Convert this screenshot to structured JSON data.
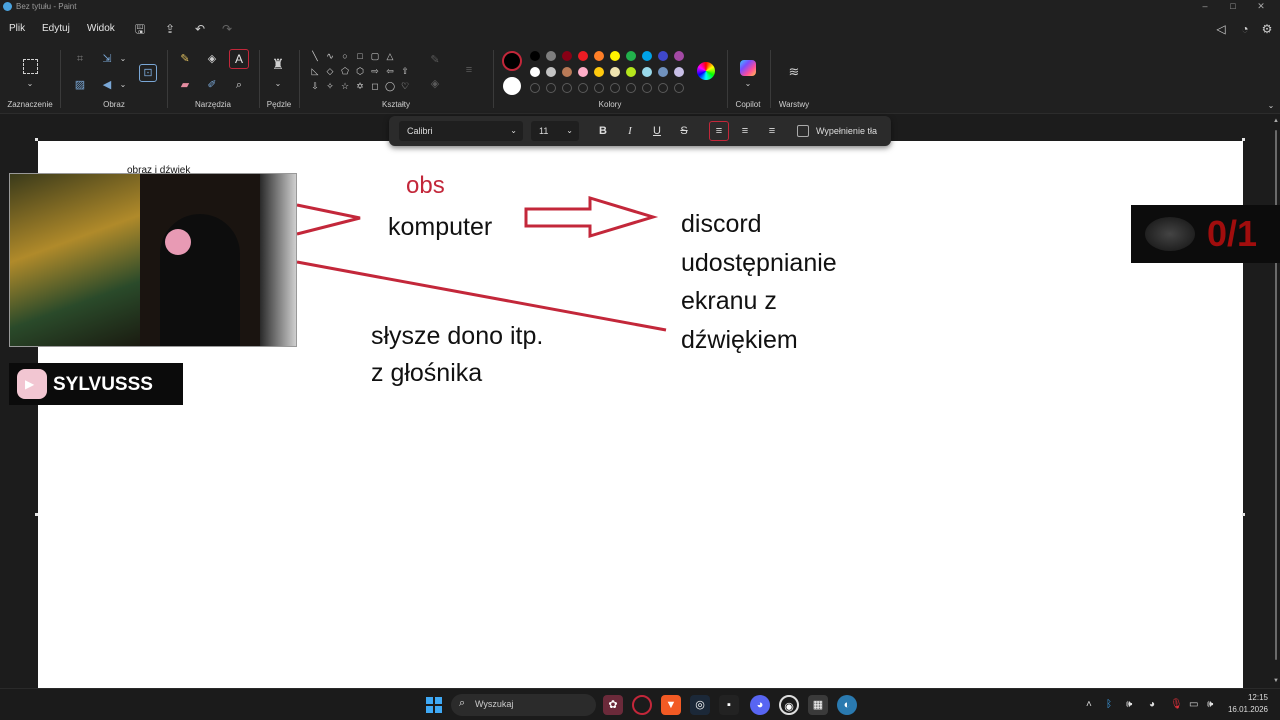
{
  "window": {
    "title": "Bez tytułu - Paint"
  },
  "menu": {
    "items": [
      "Plik",
      "Edytuj",
      "Widok"
    ]
  },
  "ribbon": {
    "groups": {
      "selection": "Zaznaczenie",
      "image": "Obraz",
      "tools": "Narzędzia",
      "brushes": "Pędzle",
      "shapes": "Kształty",
      "colors": "Kolory",
      "copilot": "Copilot",
      "layers": "Warstwy"
    }
  },
  "text_toolbar": {
    "font": "Calibri",
    "size": "11",
    "bold": "B",
    "italic": "I",
    "underline": "U",
    "strike": "S",
    "fill_label": "Wypełnienie tła"
  },
  "canvas": {
    "label_small": "obraz i dźwięk",
    "obs": "obs",
    "komputer": "komputer",
    "discord_lines": [
      "discord",
      "udostępnianie",
      "ekranu z",
      "dźwiękiem"
    ],
    "slysze_lines": [
      "słysze dono itp.",
      "z głośnika"
    ]
  },
  "overlays": {
    "logo_text": "SYLVUSSS",
    "counter_text": "0/1"
  },
  "taskbar": {
    "search": "Wyszukaj",
    "time": "12:15",
    "date": "16.01.2026"
  },
  "colors": {
    "accent_red": "#c3273a",
    "palette_row1": [
      "#000000",
      "#7f7f7f",
      "#880015",
      "#ed1c24",
      "#ff7f27",
      "#fff200",
      "#22b14c",
      "#00a2e8",
      "#3f48cc",
      "#a349a4"
    ],
    "palette_row2": [
      "#ffffff",
      "#c3c3c3",
      "#b97a57",
      "#ffaec9",
      "#ffc90e",
      "#efe4b0",
      "#b5e61d",
      "#99d9ea",
      "#7092be",
      "#c8bfe7"
    ]
  }
}
